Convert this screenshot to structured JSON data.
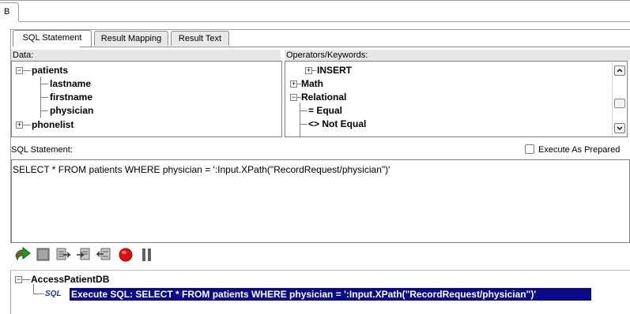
{
  "window_tab": "B",
  "tabs": [
    {
      "label": "SQL Statement",
      "active": true
    },
    {
      "label": "Result Mapping",
      "active": false
    },
    {
      "label": "Result Text",
      "active": false
    }
  ],
  "data_panel": {
    "header": "Data:",
    "tree": [
      {
        "label": "patients",
        "expanded": true
      },
      {
        "label": "lastname"
      },
      {
        "label": "firstname"
      },
      {
        "label": "physician"
      },
      {
        "label": "phonelist",
        "expanded": false
      }
    ]
  },
  "operators_panel": {
    "header": "Operators/Keywords:",
    "tree": [
      {
        "label": "INSERT",
        "expanded": false
      },
      {
        "label": "Math",
        "expanded": false
      },
      {
        "label": "Relational",
        "expanded": true
      },
      {
        "label": "= Equal"
      },
      {
        "label": "<> Not Equal"
      }
    ]
  },
  "sql_statement": {
    "label": "SQL Statement:",
    "execute_as_prepared_label": "Execute As Prepared",
    "execute_as_prepared_checked": false,
    "text": "SELECT * FROM patients WHERE physician = ':Input.XPath(\"RecordRequest/physician\")'"
  },
  "toolbar": {
    "buttons": [
      "run-icon",
      "stop-icon",
      "step-icon",
      "step-into-icon",
      "step-out-icon",
      "record-icon",
      "pause-icon"
    ]
  },
  "stream_tree": {
    "root": "AccessPatientDB",
    "child_icon_text": "SQL",
    "child_label": "Execute SQL: SELECT * FROM patients WHERE physician = ':Input.XPath(\"RecordRequest/physician\")'"
  },
  "colors": {
    "selection": "#0a0a8a",
    "record": "#e01010",
    "run": "#1a9a2a"
  }
}
